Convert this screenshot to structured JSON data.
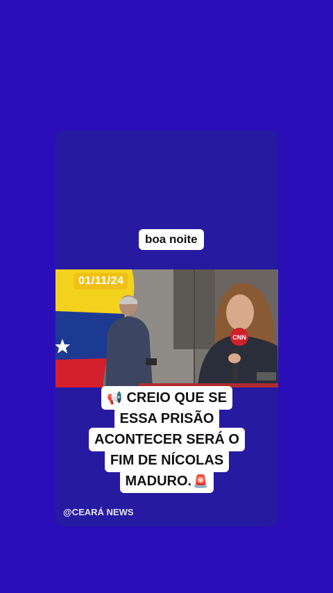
{
  "greeting": "boa noite",
  "video": {
    "date": "01/11/24",
    "channel_logo": "CNN",
    "flag": "venezuela-flag"
  },
  "caption": {
    "icon": "megaphone-icon",
    "lines": [
      "CREIO QUE SE",
      "ESSA PRISÃO",
      "ACONTECER SERÁ O",
      "FIM DE NÍCOLAS",
      "MADURO."
    ],
    "end_icon": "siren-icon"
  },
  "watermark": "@CEARÁ NEWS",
  "colors": {
    "background": "#2a0fb8",
    "card": "#251aa0",
    "date_badge": "#f0c017"
  }
}
